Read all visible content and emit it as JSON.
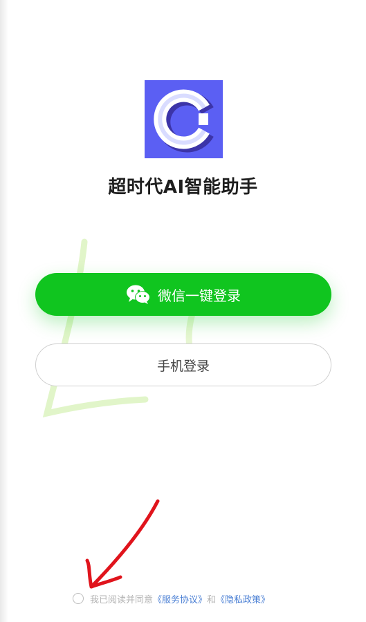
{
  "app": {
    "title": "超时代AI智能助手",
    "logo_letter": "C"
  },
  "buttons": {
    "wechat_login": "微信一键登录",
    "phone_login": "手机登录"
  },
  "agreement": {
    "prefix": "我已阅读并同意",
    "service_link": "《服务协议》",
    "conjunction": "和",
    "privacy_link": "《隐私政策》"
  },
  "colors": {
    "logo_background": "#5b5ff3",
    "wechat_green": "#10c51f",
    "link_blue": "#4a7fd4",
    "annotation_red": "#e0141c"
  },
  "icons": {
    "wechat": "wechat-icon",
    "radio": "radio-unchecked-icon"
  }
}
